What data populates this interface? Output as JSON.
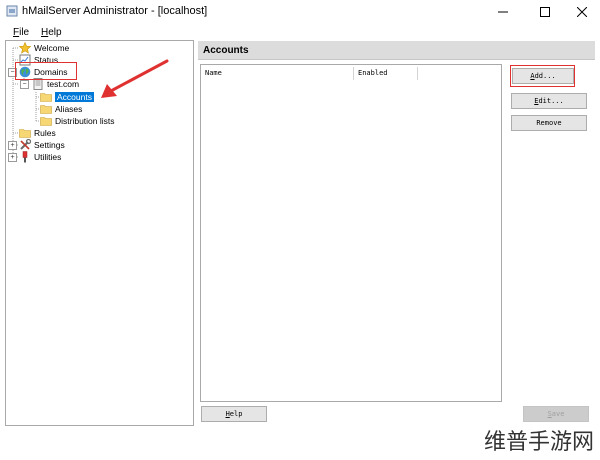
{
  "window": {
    "title": "hMailServer Administrator - [localhost]",
    "controls": {
      "minimize": "—",
      "maximize": "☐",
      "close": "✕"
    }
  },
  "menu": {
    "file": {
      "accel": "F",
      "rest": "ile"
    },
    "help": {
      "accel": "H",
      "rest": "elp"
    }
  },
  "tree": {
    "welcome": "Welcome",
    "status": "Status",
    "domains": "Domains",
    "domain_name": "test.com",
    "accounts": "Accounts",
    "aliases": "Aliases",
    "distribution_lists": "Distribution lists",
    "rules": "Rules",
    "settings": "Settings",
    "utilities": "Utilities",
    "expand_plus": "+",
    "collapse_minus": "−"
  },
  "panel": {
    "title": "Accounts",
    "columns": [
      "Name",
      "Enabled"
    ]
  },
  "buttons": {
    "add": {
      "accel": "A",
      "rest": "dd..."
    },
    "edit": {
      "accel": "E",
      "rest": "dit..."
    },
    "remove": "Remove",
    "help": {
      "accel": "H",
      "rest": "elp"
    },
    "save": {
      "accel": "S",
      "rest": "ave"
    }
  },
  "watermark": "维普手游网",
  "colors": {
    "selection": "#0078d7",
    "annotation": "#e03131",
    "header_bg": "#dcdcdc"
  }
}
